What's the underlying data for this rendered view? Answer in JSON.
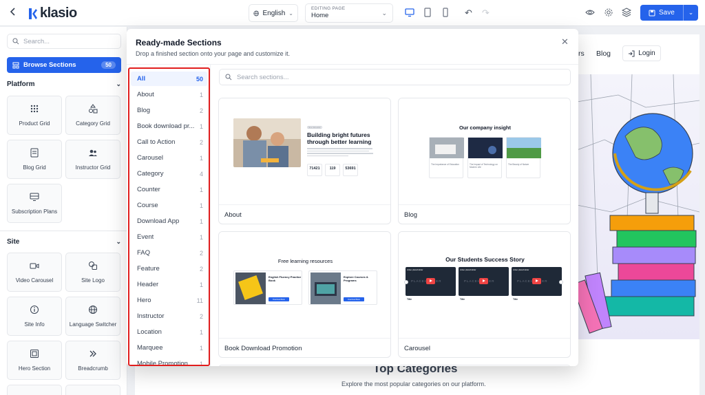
{
  "topbar": {
    "logo": "klasio",
    "language": "English",
    "editing_label": "EDITING PAGE",
    "editing_value": "Home",
    "save_label": "Save"
  },
  "sidebar": {
    "search_placeholder": "Search...",
    "browse_label": "Browse Sections",
    "browse_count": "50",
    "platform_heading": "Platform",
    "platform_tiles": [
      "Product Grid",
      "Category Grid",
      "Blog Grid",
      "Instructor Grid",
      "Subscription Plans"
    ],
    "site_heading": "Site",
    "site_tiles": [
      "Video Carousel",
      "Site Logo",
      "Site Info",
      "Language Switcher",
      "Hero Section",
      "Breadcrumb"
    ]
  },
  "canvas": {
    "nav_items": [
      "rs",
      "Blog"
    ],
    "login": "Login",
    "heading": "Top Categories",
    "subtext": "Explore the most popular categories on our platform."
  },
  "modal": {
    "title": "Ready-made Sections",
    "subtitle": "Drop a finished section onto your page and customize it.",
    "search_placeholder": "Search sections...",
    "categories": [
      {
        "label": "All",
        "count": "50"
      },
      {
        "label": "About",
        "count": "1"
      },
      {
        "label": "Blog",
        "count": "2"
      },
      {
        "label": "Book download pr...",
        "count": "1"
      },
      {
        "label": "Call to Action",
        "count": "2"
      },
      {
        "label": "Carousel",
        "count": "1"
      },
      {
        "label": "Category",
        "count": "4"
      },
      {
        "label": "Counter",
        "count": "1"
      },
      {
        "label": "Course",
        "count": "1"
      },
      {
        "label": "Download App",
        "count": "1"
      },
      {
        "label": "Event",
        "count": "1"
      },
      {
        "label": "FAQ",
        "count": "2"
      },
      {
        "label": "Feature",
        "count": "2"
      },
      {
        "label": "Header",
        "count": "1"
      },
      {
        "label": "Hero",
        "count": "11"
      },
      {
        "label": "Instructor",
        "count": "2"
      },
      {
        "label": "Location",
        "count": "1"
      },
      {
        "label": "Marquee",
        "count": "1"
      },
      {
        "label": "Mobile Promotion",
        "count": "1"
      }
    ],
    "cards": [
      {
        "name": "About",
        "preview": {
          "tag": "About Education",
          "heading1": "Building bright futures",
          "heading2": "through better learning",
          "stats": [
            "71421",
            "119",
            "53691"
          ]
        }
      },
      {
        "name": "Blog",
        "preview": {
          "heading": "Our company insight",
          "posts": [
            "The Importance of Education",
            "The Impact of Technology on Modern Life",
            "The Beauty of Nature"
          ]
        }
      },
      {
        "name": "Book Download Promotion",
        "preview": {
          "heading": "Free learning resources",
          "items": [
            {
              "title": "English Fluency Practice Book",
              "cta": "Download Book"
            },
            {
              "title": "Explore Courses & Programs",
              "cta": "Download Book"
            }
          ]
        }
      },
      {
        "name": "Carousel",
        "preview": {
          "heading": "Our Students Success Story",
          "video_label": "video placeholder",
          "placeholder_text": "PLACEHOLDER",
          "captions": [
            "Title",
            "Title",
            "Title"
          ]
        }
      }
    ]
  },
  "colors": {
    "primary": "#2563eb",
    "highlight_border": "#e11d1d"
  }
}
